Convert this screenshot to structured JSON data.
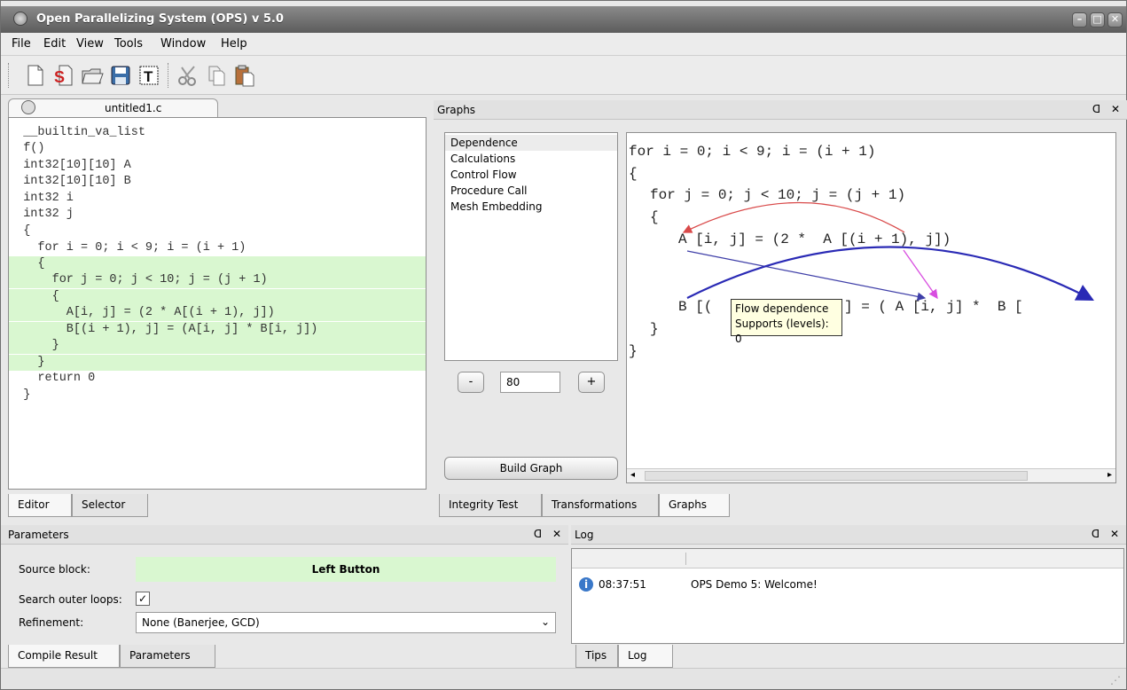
{
  "window": {
    "title": "Open Parallelizing System (OPS) v 5.0"
  },
  "menu": [
    "File",
    "Edit",
    "View",
    "Tools",
    "Window",
    "Help"
  ],
  "toolbar": {
    "icons": [
      "new-file-icon",
      "open-s-icon",
      "open-folder-icon",
      "save-icon",
      "text-icon",
      "cut-icon",
      "copy-icon",
      "paste-icon"
    ]
  },
  "editor": {
    "tab": "untitled1.c",
    "lines": [
      "  __builtin_va_list",
      "  f()",
      "  int32[10][10] A",
      "  int32[10][10] B",
      "  int32 i",
      "  int32 j",
      "  {",
      "    for i = 0; i < 9; i = (i + 1)",
      "    {",
      "      for j = 0; j < 10; j = (j + 1)",
      "      {",
      "        A[i, j] = (2 * A[(i + 1), j])",
      "        B[(i + 1), j] = (A[i, j] * B[i, j])",
      "      }",
      "    }",
      "    return 0",
      "  }"
    ],
    "highlighted_from": 8,
    "highlighted_to": 14
  },
  "left_bottom_tabs": [
    "Editor",
    "Selector"
  ],
  "graphs": {
    "title": "Graphs",
    "list": [
      "Dependence",
      "Calculations",
      "Control Flow",
      "Procedure Call",
      "Mesh Embedding"
    ],
    "selected": "Dependence",
    "zoom_minus": "-",
    "zoom_plus": "+",
    "zoom_value": "80",
    "build_button": "Build Graph",
    "code": {
      "l1": "for i = 0; i < 9; i = (i + 1)",
      "l2": "{",
      "l3": "for j = 0; j < 10; j = (j + 1)",
      "l4": "{",
      "l5": "A [i, j] = (2 *  A [(i + 1), j])",
      "l6": "B [(",
      "l6b": "] = ( A [i, j] *  B [",
      "l7": "}",
      "l8": "}"
    },
    "tooltip": {
      "line1": "Flow dependence",
      "line2": "Supports (levels): 0"
    },
    "arrow_colors": {
      "anti": "#d94a4a",
      "flow": "#3f3fa8",
      "output": "#2a2ab5",
      "input": "#d84de0"
    }
  },
  "right_bottom_tabs": [
    "Integrity Test",
    "Transformations",
    "Graphs"
  ],
  "parameters": {
    "title": "Parameters",
    "source_block_label": "Source block:",
    "source_block_value": "Left Button",
    "outer_loops_label": "Search outer loops:",
    "outer_loops_checked": "✓",
    "refinement_label": "Refinement:",
    "refinement_value": "None (Banerjee, GCD)"
  },
  "params_bottom_tabs": [
    "Compile Result",
    "Parameters"
  ],
  "log": {
    "title": "Log",
    "entry_time": "08:37:51",
    "entry_message": "OPS Demo 5: Welcome!"
  },
  "log_bottom_tabs": [
    "Tips",
    "Log"
  ],
  "dock_buttons": "ᗡ ✕"
}
